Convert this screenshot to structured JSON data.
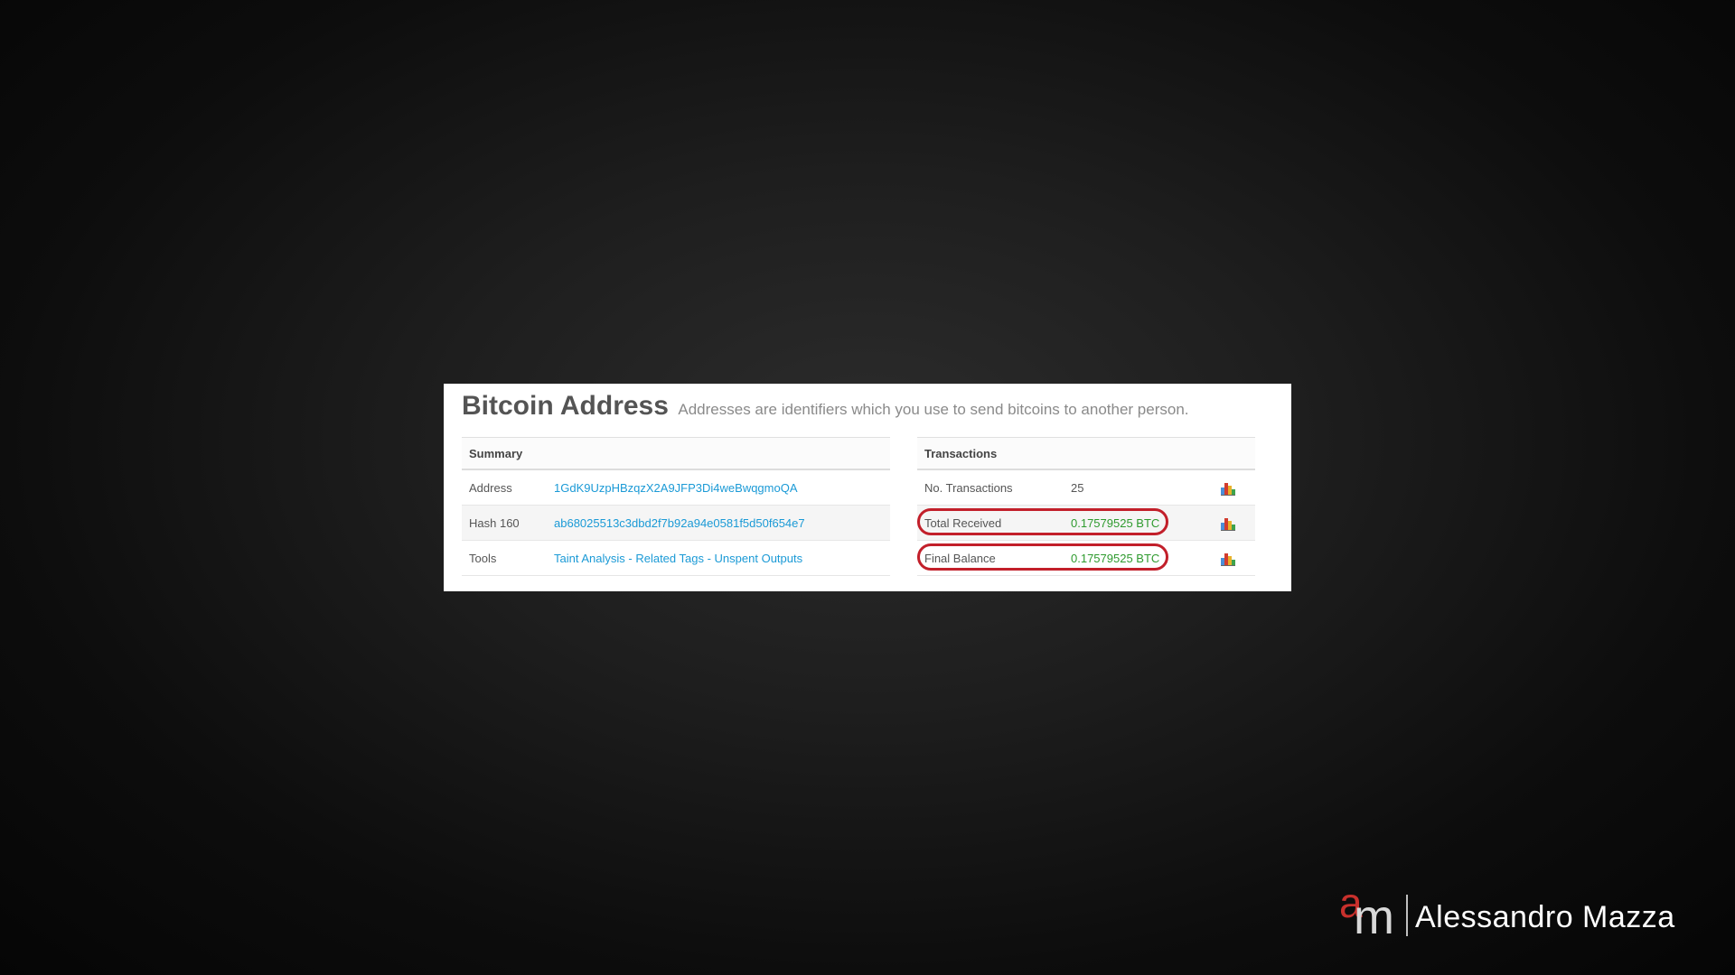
{
  "page": {
    "title": "Bitcoin Address",
    "subtitle": "Addresses are identifiers which you use to send bitcoins to another person."
  },
  "summary": {
    "header": "Summary",
    "rows": [
      {
        "label": "Address",
        "value": "1GdK9UzpHBzqzX2A9JFP3Di4weBwqgmoQA"
      },
      {
        "label": "Hash 160",
        "value": "ab68025513c3dbd2f7b92a94e0581f5d50f654e7"
      },
      {
        "label": "Tools",
        "links": [
          "Taint Analysis",
          "Related Tags",
          "Unspent Outputs"
        ],
        "separator": " - "
      }
    ]
  },
  "transactions": {
    "header": "Transactions",
    "rows": [
      {
        "label": "No. Transactions",
        "value": "25",
        "icon": "bar-chart-icon"
      },
      {
        "label": "Total Received",
        "value": "0.17579525 BTC",
        "icon": "bar-chart-icon",
        "highlighted": true
      },
      {
        "label": "Final Balance",
        "value": "0.17579525 BTC",
        "icon": "bar-chart-icon",
        "highlighted": true
      }
    ]
  },
  "colors": {
    "link": "#1b9ad6",
    "positive": "#2e9a2e",
    "highlight": "#c21f2a",
    "brand_accent": "#c8302c"
  },
  "branding": {
    "monogram_a": "a",
    "monogram_m": "m",
    "name": "Alessandro Mazza"
  }
}
